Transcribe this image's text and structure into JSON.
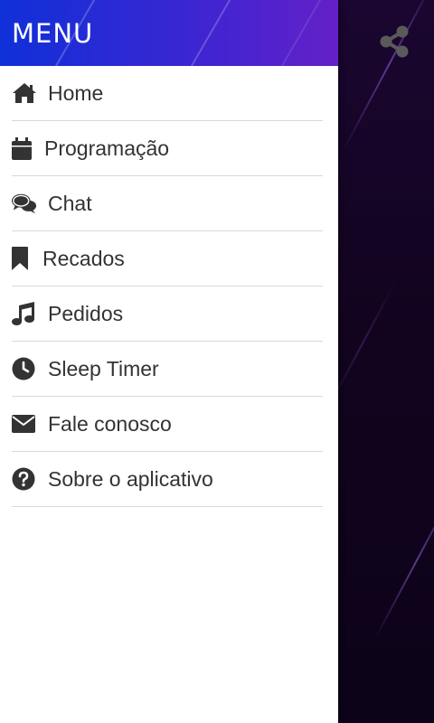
{
  "drawer": {
    "title": "MENU",
    "items": [
      {
        "label": "Home",
        "icon": "home-icon"
      },
      {
        "label": "Programação",
        "icon": "calendar-icon"
      },
      {
        "label": "Chat",
        "icon": "chat-icon"
      },
      {
        "label": "Recados",
        "icon": "bookmark-icon"
      },
      {
        "label": "Pedidos",
        "icon": "music-icon"
      },
      {
        "label": "Sleep Timer",
        "icon": "clock-icon"
      },
      {
        "label": "Fale conosco",
        "icon": "envelope-icon"
      },
      {
        "label": "Sobre o aplicativo",
        "icon": "question-icon"
      }
    ]
  },
  "toolbar": {
    "share_icon": "share-icon"
  },
  "colors": {
    "header_start": "#1030d8",
    "header_end": "#6420c8",
    "background": "#12041f",
    "icon": "#333333"
  }
}
